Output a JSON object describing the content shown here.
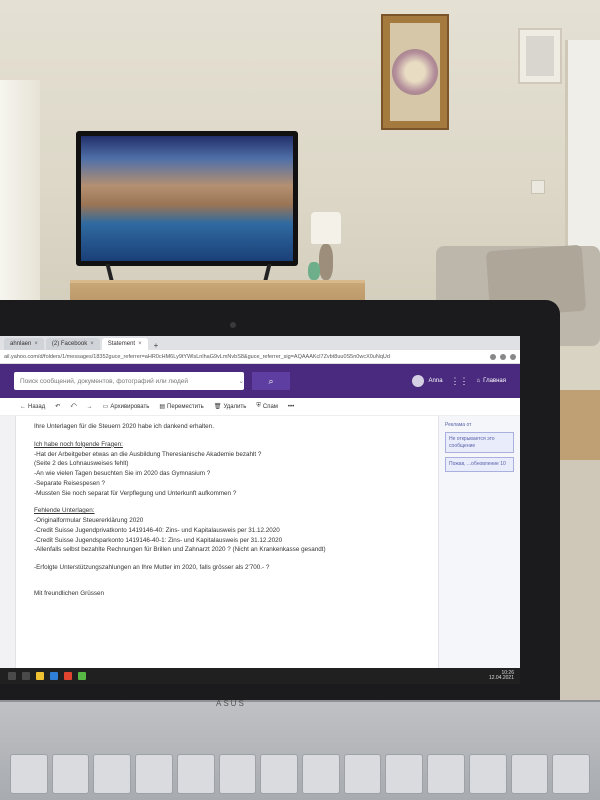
{
  "browser": {
    "tabs": [
      {
        "label": "ahnlaen",
        "active": false
      },
      {
        "label": "(2) Facebook",
        "active": false
      },
      {
        "label": "Statement",
        "active": true
      }
    ],
    "new_tab": "+",
    "url": "ail.yahoo.com/d/folders/1/messages/18352guce_referrer=aHR0cHM6Ly9tYWlsLnlhaG9vLmNvbS8&guce_referrer_sig=AQAAAKcl7Zvbt8uu0S5n0wcX0uNqUd"
  },
  "mail": {
    "search_placeholder": "Поиск сообщений, документов, фотографий или людей",
    "search_button": "⌕",
    "user_name": "Anna",
    "home_label": "Главная",
    "toolbar": {
      "back": "Назад",
      "archive": "Архивировать",
      "move": "Переместить",
      "delete": "Удалить",
      "spam": "Спам",
      "more": "•••"
    },
    "message_lines": [
      "Ihre Unterlagen für die Steuern 2020 habe ich dankend erhalten.",
      "",
      "Ich habe noch folgende Fragen:",
      "-Hat der Arbeitgeber etwas an die Ausbildung  Theresianische Akademie bezahlt ?",
      " (Seite 2 des Lohnausweises fehlt)",
      "-An wie vielen Tagen besuchten Sie im 2020 das Gymnasium ?",
      "-Separate Reisespesen ?",
      "-Mussten Sie noch separat für Verpflegung und Unterkunft aufkommen ?",
      "",
      "Fehlende Unterlagen:",
      "-Originalformular Steuererklärung 2020",
      "-Credit Suisse Jugendprivatkonto 1419146-40: Zins- und Kapitalausweis per 31.12.2020",
      "-Credit Suisse Jugendsparkonto 1419146-40-1: Zins- und Kapitalausweis per 31.12.2020",
      "-Allenfalls selbst bezahlte Rechnungen für Brillen und Zahnarzt 2020 ? (Nicht an Krankenkasse gesandt)",
      "",
      "-Erfolgte Unterstützungszahlungen an Ihre Mutter im 2020, falls grösser als 2'700.- ?",
      "",
      "",
      "Mit freundlichen Grüssen"
    ],
    "right_panel": {
      "title": "Реклама от",
      "box1": "Не открывается это сообщение",
      "box2": "Пожав, ...обновление 10"
    }
  },
  "taskbar": {
    "clock_time": "10:26",
    "clock_date": "12.04.2021"
  },
  "laptop": {
    "brand": "ASUS"
  }
}
